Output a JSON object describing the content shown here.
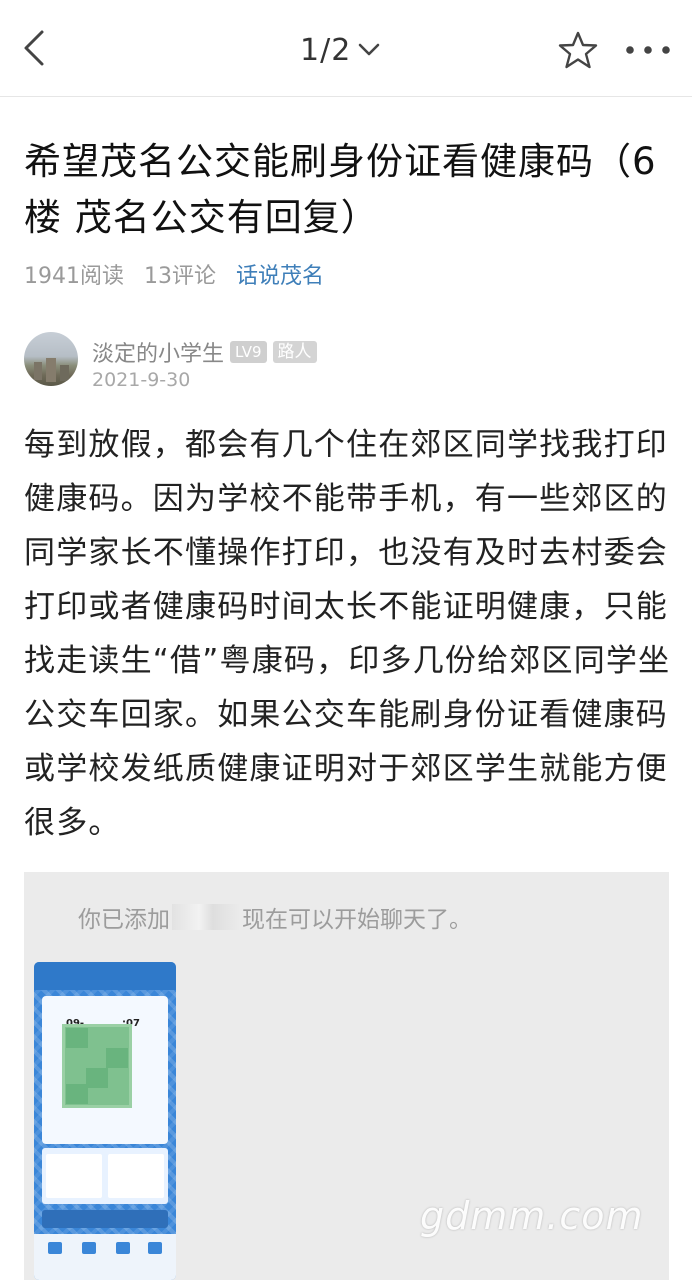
{
  "header": {
    "page_indicator": "1/2",
    "icons": [
      "back-arrow-icon",
      "chevron-down-icon",
      "star-icon",
      "more-dots-icon"
    ]
  },
  "post": {
    "title": "希望茂名公交能刷身份证看健康码（6楼 茂名公交有回复）",
    "reads": "1941阅读",
    "comments": "13评论",
    "forum": "话说茂名"
  },
  "author": {
    "name": "淡定的小学生",
    "level": "LV9",
    "role": "路人",
    "date": "2021-9-30"
  },
  "content": {
    "text": "每到放假，都会有几个住在郊区同学找我打印健康码。因为学校不能带手机，有一些郊区的同学家长不懂操作打印，也没有及时去村委会打印或者健康码时间太长不能证明健康，只能找走读生“借”粤康码，印多几份给郊区同学坐公交车回家。如果公交车能刷身份证看健康码或学校发纸质健康证明对于郊区学生就能方便很多。"
  },
  "image": {
    "system_message_prefix": "你已添加",
    "system_message_suffix": "现在可以开始聊天了。",
    "phone_time_left": "09-",
    "phone_time_right": ":07",
    "watermark": "gdmm.com"
  }
}
